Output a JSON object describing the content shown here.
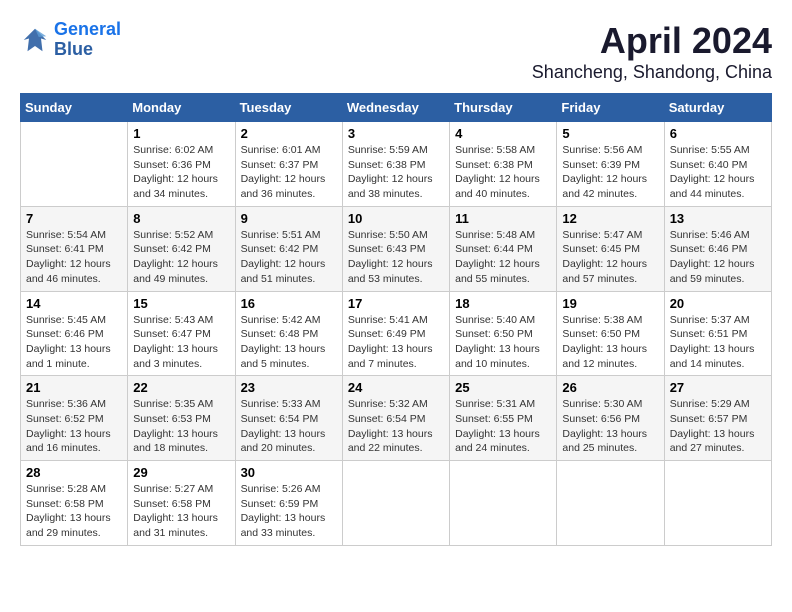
{
  "logo": {
    "line1": "General",
    "line2": "Blue"
  },
  "title": "April 2024",
  "subtitle": "Shancheng, Shandong, China",
  "days_of_week": [
    "Sunday",
    "Monday",
    "Tuesday",
    "Wednesday",
    "Thursday",
    "Friday",
    "Saturday"
  ],
  "weeks": [
    [
      null,
      {
        "day": 1,
        "sunrise": "6:02 AM",
        "sunset": "6:36 PM",
        "daylight": "12 hours and 34 minutes."
      },
      {
        "day": 2,
        "sunrise": "6:01 AM",
        "sunset": "6:37 PM",
        "daylight": "12 hours and 36 minutes."
      },
      {
        "day": 3,
        "sunrise": "5:59 AM",
        "sunset": "6:38 PM",
        "daylight": "12 hours and 38 minutes."
      },
      {
        "day": 4,
        "sunrise": "5:58 AM",
        "sunset": "6:38 PM",
        "daylight": "12 hours and 40 minutes."
      },
      {
        "day": 5,
        "sunrise": "5:56 AM",
        "sunset": "6:39 PM",
        "daylight": "12 hours and 42 minutes."
      },
      {
        "day": 6,
        "sunrise": "5:55 AM",
        "sunset": "6:40 PM",
        "daylight": "12 hours and 44 minutes."
      }
    ],
    [
      {
        "day": 7,
        "sunrise": "5:54 AM",
        "sunset": "6:41 PM",
        "daylight": "12 hours and 46 minutes."
      },
      {
        "day": 8,
        "sunrise": "5:52 AM",
        "sunset": "6:42 PM",
        "daylight": "12 hours and 49 minutes."
      },
      {
        "day": 9,
        "sunrise": "5:51 AM",
        "sunset": "6:42 PM",
        "daylight": "12 hours and 51 minutes."
      },
      {
        "day": 10,
        "sunrise": "5:50 AM",
        "sunset": "6:43 PM",
        "daylight": "12 hours and 53 minutes."
      },
      {
        "day": 11,
        "sunrise": "5:48 AM",
        "sunset": "6:44 PM",
        "daylight": "12 hours and 55 minutes."
      },
      {
        "day": 12,
        "sunrise": "5:47 AM",
        "sunset": "6:45 PM",
        "daylight": "12 hours and 57 minutes."
      },
      {
        "day": 13,
        "sunrise": "5:46 AM",
        "sunset": "6:46 PM",
        "daylight": "12 hours and 59 minutes."
      }
    ],
    [
      {
        "day": 14,
        "sunrise": "5:45 AM",
        "sunset": "6:46 PM",
        "daylight": "13 hours and 1 minute."
      },
      {
        "day": 15,
        "sunrise": "5:43 AM",
        "sunset": "6:47 PM",
        "daylight": "13 hours and 3 minutes."
      },
      {
        "day": 16,
        "sunrise": "5:42 AM",
        "sunset": "6:48 PM",
        "daylight": "13 hours and 5 minutes."
      },
      {
        "day": 17,
        "sunrise": "5:41 AM",
        "sunset": "6:49 PM",
        "daylight": "13 hours and 7 minutes."
      },
      {
        "day": 18,
        "sunrise": "5:40 AM",
        "sunset": "6:50 PM",
        "daylight": "13 hours and 10 minutes."
      },
      {
        "day": 19,
        "sunrise": "5:38 AM",
        "sunset": "6:50 PM",
        "daylight": "13 hours and 12 minutes."
      },
      {
        "day": 20,
        "sunrise": "5:37 AM",
        "sunset": "6:51 PM",
        "daylight": "13 hours and 14 minutes."
      }
    ],
    [
      {
        "day": 21,
        "sunrise": "5:36 AM",
        "sunset": "6:52 PM",
        "daylight": "13 hours and 16 minutes."
      },
      {
        "day": 22,
        "sunrise": "5:35 AM",
        "sunset": "6:53 PM",
        "daylight": "13 hours and 18 minutes."
      },
      {
        "day": 23,
        "sunrise": "5:33 AM",
        "sunset": "6:54 PM",
        "daylight": "13 hours and 20 minutes."
      },
      {
        "day": 24,
        "sunrise": "5:32 AM",
        "sunset": "6:54 PM",
        "daylight": "13 hours and 22 minutes."
      },
      {
        "day": 25,
        "sunrise": "5:31 AM",
        "sunset": "6:55 PM",
        "daylight": "13 hours and 24 minutes."
      },
      {
        "day": 26,
        "sunrise": "5:30 AM",
        "sunset": "6:56 PM",
        "daylight": "13 hours and 25 minutes."
      },
      {
        "day": 27,
        "sunrise": "5:29 AM",
        "sunset": "6:57 PM",
        "daylight": "13 hours and 27 minutes."
      }
    ],
    [
      {
        "day": 28,
        "sunrise": "5:28 AM",
        "sunset": "6:58 PM",
        "daylight": "13 hours and 29 minutes."
      },
      {
        "day": 29,
        "sunrise": "5:27 AM",
        "sunset": "6:58 PM",
        "daylight": "13 hours and 31 minutes."
      },
      {
        "day": 30,
        "sunrise": "5:26 AM",
        "sunset": "6:59 PM",
        "daylight": "13 hours and 33 minutes."
      },
      null,
      null,
      null,
      null
    ]
  ]
}
